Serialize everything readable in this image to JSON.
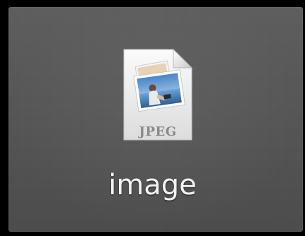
{
  "preview": {
    "file_type_label": "JPEG",
    "file_name": "image",
    "icon": "jpeg-file-icon"
  }
}
